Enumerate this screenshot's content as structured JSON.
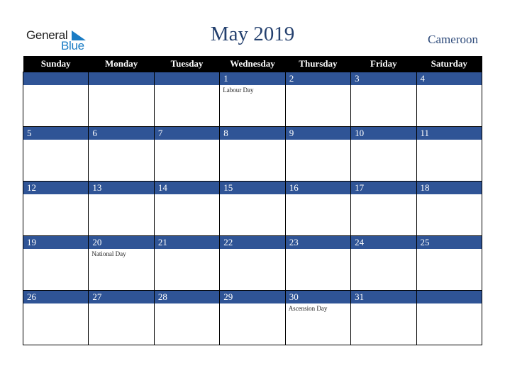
{
  "logo": {
    "word1": "General",
    "word2": "Blue"
  },
  "header": {
    "title": "May 2019",
    "country": "Cameroon"
  },
  "colors": {
    "band": "#2f5496",
    "header_bg": "#000000",
    "title": "#24406e",
    "logo_blue": "#1a7cc4"
  },
  "weekdays": [
    "Sunday",
    "Monday",
    "Tuesday",
    "Wednesday",
    "Thursday",
    "Friday",
    "Saturday"
  ],
  "weeks": [
    [
      {
        "day": "",
        "event": ""
      },
      {
        "day": "",
        "event": ""
      },
      {
        "day": "",
        "event": ""
      },
      {
        "day": "1",
        "event": "Labour Day"
      },
      {
        "day": "2",
        "event": ""
      },
      {
        "day": "3",
        "event": ""
      },
      {
        "day": "4",
        "event": ""
      }
    ],
    [
      {
        "day": "5",
        "event": ""
      },
      {
        "day": "6",
        "event": ""
      },
      {
        "day": "7",
        "event": ""
      },
      {
        "day": "8",
        "event": ""
      },
      {
        "day": "9",
        "event": ""
      },
      {
        "day": "10",
        "event": ""
      },
      {
        "day": "11",
        "event": ""
      }
    ],
    [
      {
        "day": "12",
        "event": ""
      },
      {
        "day": "13",
        "event": ""
      },
      {
        "day": "14",
        "event": ""
      },
      {
        "day": "15",
        "event": ""
      },
      {
        "day": "16",
        "event": ""
      },
      {
        "day": "17",
        "event": ""
      },
      {
        "day": "18",
        "event": ""
      }
    ],
    [
      {
        "day": "19",
        "event": ""
      },
      {
        "day": "20",
        "event": "National Day"
      },
      {
        "day": "21",
        "event": ""
      },
      {
        "day": "22",
        "event": ""
      },
      {
        "day": "23",
        "event": ""
      },
      {
        "day": "24",
        "event": ""
      },
      {
        "day": "25",
        "event": ""
      }
    ],
    [
      {
        "day": "26",
        "event": ""
      },
      {
        "day": "27",
        "event": ""
      },
      {
        "day": "28",
        "event": ""
      },
      {
        "day": "29",
        "event": ""
      },
      {
        "day": "30",
        "event": "Ascension Day"
      },
      {
        "day": "31",
        "event": ""
      },
      {
        "day": "",
        "event": ""
      }
    ]
  ]
}
